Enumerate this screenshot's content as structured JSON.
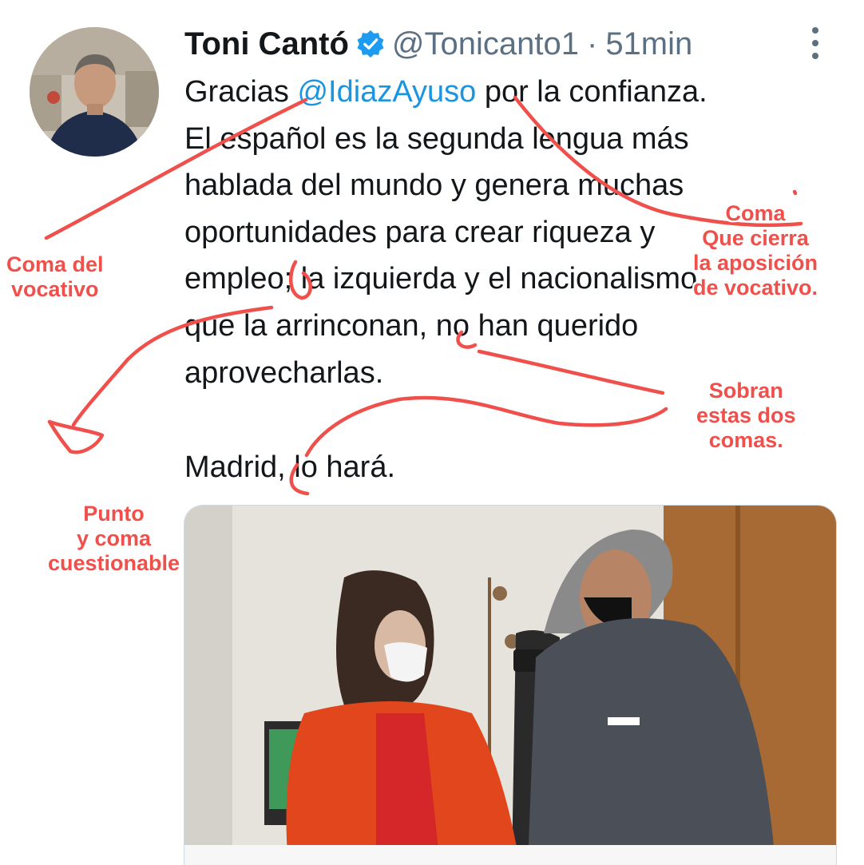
{
  "tweet": {
    "author_name": "Toni Cantó",
    "handle": "@Tonicanto1",
    "separator": "·",
    "time": "51min",
    "text_lines": [
      {
        "before": "Gracias ",
        "mention": "@IdiazAyuso",
        "after": " por la confianza."
      },
      {
        "text": "El español es la segunda lengua más"
      },
      {
        "text": "hablada del mundo y genera muchas"
      },
      {
        "text": "oportunidades para crear riqueza y"
      },
      {
        "text": "empleo; la izquierda y el nacionalismo"
      },
      {
        "text": "que la arrinconan, no han querido"
      },
      {
        "text": "aprovecharlas."
      }
    ],
    "signoff": "Madrid, lo hará."
  },
  "annotations": {
    "coma_del_vocativo": [
      "Coma del",
      "vocativo"
    ],
    "coma_aposicion": [
      "Coma",
      "Que cierra",
      "la aposición",
      "de vocativo."
    ],
    "sobran_comas": [
      "Sobran",
      "estas dos",
      "comas."
    ],
    "punto_y_coma": [
      "Punto",
      "y coma",
      "cuestionable"
    ]
  },
  "colors": {
    "text": "#14171a",
    "secondary": "#5b7083",
    "link": "#1b95e0",
    "verified": "#1d9bf0",
    "ink": "#f0504b"
  },
  "icons": {
    "verified": "verified-badge-icon",
    "more": "more-vertical-icon"
  }
}
